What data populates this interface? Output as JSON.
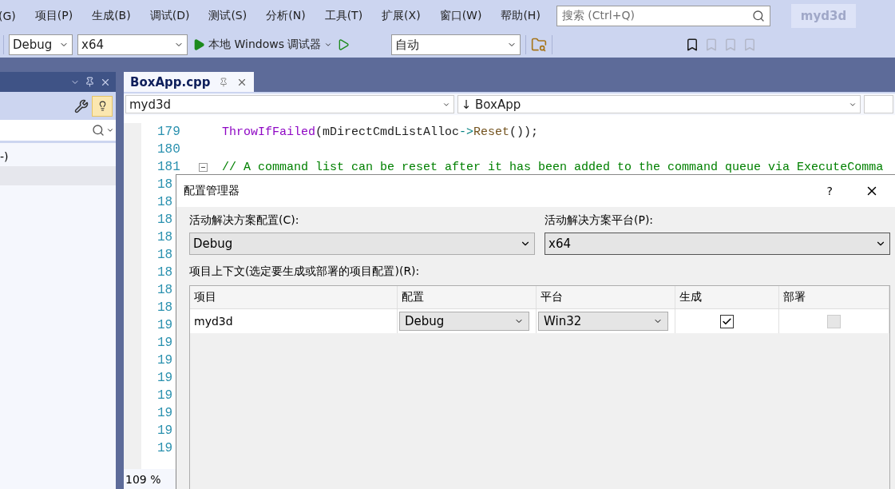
{
  "menu": [
    "(G)",
    "项目(P)",
    "生成(B)",
    "调试(D)",
    "测试(S)",
    "分析(N)",
    "工具(T)",
    "扩展(X)",
    "窗口(W)",
    "帮助(H)"
  ],
  "search": {
    "placeholder": "搜索 (Ctrl+Q)"
  },
  "solution_name": "myd3d",
  "toolbar": {
    "configuration": "Debug",
    "platform": "x64",
    "run_label": "本地 Windows 调试器",
    "target": "自动"
  },
  "left_panel": {
    "tree": [
      {
        "label": "-)",
        "selected": false
      },
      {
        "selected": true
      }
    ]
  },
  "editor": {
    "tabs": [
      {
        "label": "BoxApp.cpp",
        "selected": true
      }
    ],
    "nav": [
      "myd3d",
      "↓ BoxApp"
    ],
    "lines": [
      {
        "number": "179",
        "fold": false,
        "tokens": [
          {
            "kind": "func",
            "text": "ThrowIfFailed"
          },
          {
            "kind": "plain",
            "text": "(mDirectCmdListAlloc"
          },
          {
            "kind": "op",
            "text": "->"
          },
          {
            "kind": "method",
            "text": "Reset"
          },
          {
            "kind": "plain",
            "text": "());"
          }
        ]
      },
      {
        "number": "180",
        "fold": false
      },
      {
        "number": "181",
        "fold": true,
        "tokens": [
          {
            "kind": "comment",
            "text": "// A command list can be reset after it has been added to the command queue via ExecuteComma"
          }
        ]
      },
      {
        "number": "18"
      },
      {
        "number": "18"
      },
      {
        "number": "18"
      },
      {
        "number": "18"
      },
      {
        "number": "18"
      },
      {
        "number": "18"
      },
      {
        "number": "18"
      },
      {
        "number": "18"
      },
      {
        "number": "19"
      },
      {
        "number": "19"
      },
      {
        "number": "19"
      },
      {
        "number": "19"
      },
      {
        "number": "19"
      },
      {
        "number": "19"
      },
      {
        "number": "19"
      },
      {
        "number": "19"
      }
    ],
    "zoom": "109 %"
  },
  "dialog": {
    "title": "配置管理器",
    "help": "?",
    "config_label": "活动解决方案配置(C):",
    "config_value": "Debug",
    "platform_label": "活动解决方案平台(P):",
    "platform_value": "x64",
    "context_label": "项目上下文(选定要生成或部署的项目配置)(R):",
    "columns": [
      "项目",
      "配置",
      "平台",
      "生成",
      "部署"
    ],
    "rows": [
      {
        "project": "myd3d",
        "configuration": "Debug",
        "platform": "Win32",
        "build": true,
        "build_disabled": false,
        "deploy": false,
        "deploy_disabled": true
      }
    ]
  }
}
